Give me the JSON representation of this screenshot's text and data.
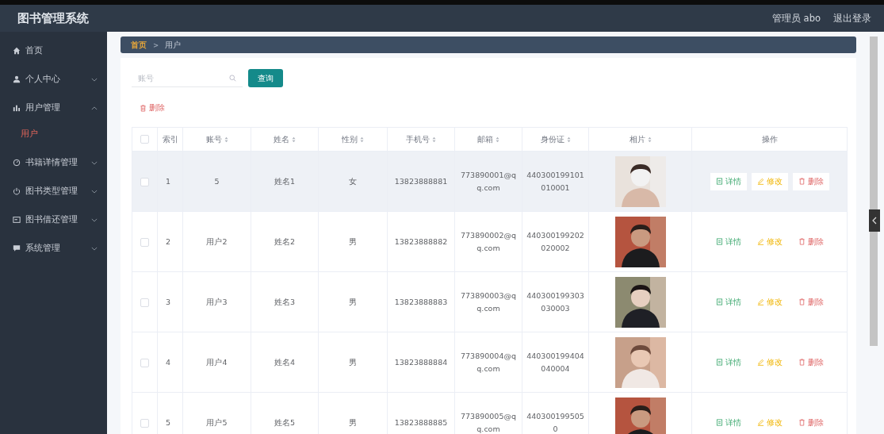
{
  "header": {
    "title": "图书管理系统",
    "user": "管理员 abo",
    "logout": "退出登录"
  },
  "sidebar": {
    "items": [
      {
        "label": "首页"
      },
      {
        "label": "个人中心",
        "expanded": false
      },
      {
        "label": "用户管理",
        "expanded": true,
        "children": [
          {
            "label": "用户",
            "selected": true
          }
        ]
      },
      {
        "label": "书籍详情管理",
        "expanded": false
      },
      {
        "label": "图书类型管理",
        "expanded": false
      },
      {
        "label": "图书借还管理",
        "expanded": false
      },
      {
        "label": "系统管理",
        "expanded": false
      }
    ]
  },
  "breadcrumb": [
    {
      "label": "首页",
      "selected": true
    },
    {
      "label": ">",
      "kind": "separator"
    },
    {
      "label": "用户",
      "selected": false
    }
  ],
  "search": {
    "placeholder": "账号",
    "button": "查询"
  },
  "delete_button": "删除",
  "table": {
    "select_all": {
      "checked": false
    },
    "columns": [
      {
        "label": "索引",
        "sortable": false
      },
      {
        "label": "账号",
        "sortable": true
      },
      {
        "label": "姓名",
        "sortable": true
      },
      {
        "label": "性别",
        "sortable": true
      },
      {
        "label": "手机号",
        "sortable": true
      },
      {
        "label": "邮箱",
        "sortable": true
      },
      {
        "label": "身份证",
        "sortable": true
      },
      {
        "label": "相片",
        "sortable": true
      },
      {
        "label": "操作",
        "sortable": false
      }
    ],
    "rows": [
      {
        "checked": false,
        "hover": true,
        "cells": [
          "1",
          "5",
          "姓名1",
          "女",
          "13823888881",
          "773890001@qq.com",
          "440300199101010001"
        ],
        "actions": [
          "详情",
          "修改",
          "删除"
        ]
      },
      {
        "checked": false,
        "hover": false,
        "cells": [
          "2",
          "用户2",
          "姓名2",
          "男",
          "13823888882",
          "773890002@qq.com",
          "440300199202020002"
        ],
        "actions": [
          "详情",
          "修改",
          "删除"
        ]
      },
      {
        "checked": false,
        "hover": false,
        "cells": [
          "3",
          "用户3",
          "姓名3",
          "男",
          "13823888883",
          "773890003@qq.com",
          "440300199303030003"
        ],
        "actions": [
          "详情",
          "修改",
          "删除"
        ]
      },
      {
        "checked": false,
        "hover": false,
        "cells": [
          "4",
          "用户4",
          "姓名4",
          "男",
          "13823888884",
          "773890004@qq.com",
          "440300199404040004"
        ],
        "actions": [
          "详情",
          "修改",
          "删除"
        ]
      },
      {
        "checked": false,
        "hover": false,
        "cells": [
          "5",
          "用户5",
          "姓名5",
          "男",
          "13823888885",
          "773890005@qq.com",
          "4403001995050"
        ],
        "actions": [
          "详情",
          "修改",
          "删除"
        ]
      }
    ]
  }
}
